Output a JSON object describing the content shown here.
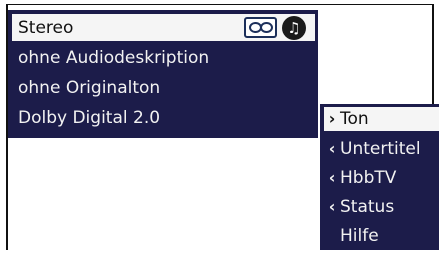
{
  "audio_menu": {
    "selected": "Stereo",
    "icons": [
      "stereo-icon",
      "music-note-icon"
    ],
    "options": [
      "ohne Audiodeskription",
      "ohne Originalton",
      "Dolby Digital 2.0"
    ]
  },
  "side_menu": {
    "items": [
      {
        "label": "Ton",
        "chevron": "›",
        "icon": "chevron-right-icon"
      },
      {
        "label": "Untertitel",
        "chevron": "‹",
        "icon": "chevron-left-icon"
      },
      {
        "label": "HbbTV",
        "chevron": "‹",
        "icon": "chevron-left-icon"
      },
      {
        "label": "Status",
        "chevron": "‹",
        "icon": "chevron-left-icon"
      },
      {
        "label": "Hilfe",
        "chevron": "",
        "icon": ""
      }
    ]
  },
  "colors": {
    "panel_bg": "#1c1c4a",
    "highlight_bg": "#f5f5f5",
    "text_light": "#f2f2f2",
    "text_dark": "#111111"
  }
}
